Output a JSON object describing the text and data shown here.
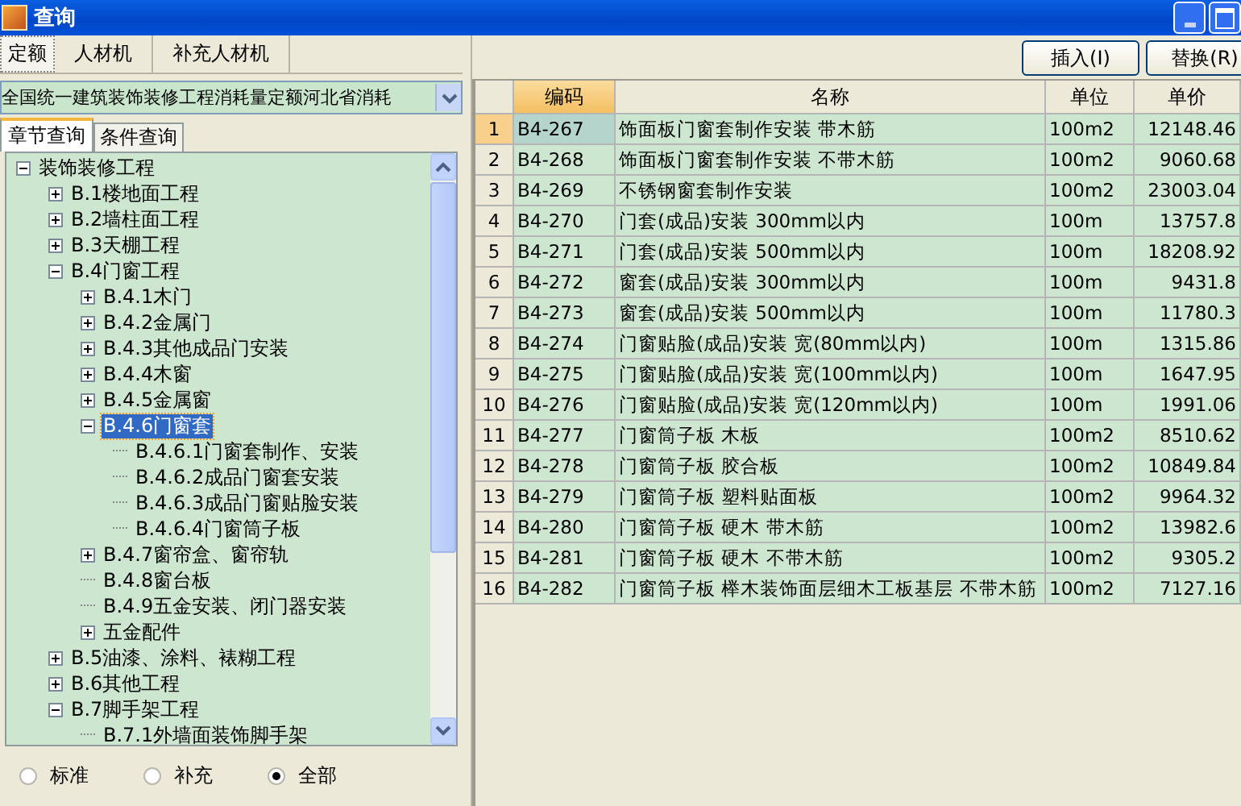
{
  "window": {
    "title": "查询"
  },
  "tabs": [
    {
      "label": "定额",
      "selected": true
    },
    {
      "label": "人材机",
      "selected": false
    },
    {
      "label": "补充人材机",
      "selected": false
    }
  ],
  "library": {
    "value": "全国统一建筑装饰装修工程消耗量定额河北省消耗"
  },
  "query_tabs": [
    {
      "label": "章节查询",
      "selected": true
    },
    {
      "label": "条件查询",
      "selected": false
    }
  ],
  "tree": [
    {
      "label": "装饰装修工程",
      "expanded": true,
      "selected": false,
      "children": [
        {
          "label": "B.1楼地面工程",
          "expanded": false,
          "selected": false
        },
        {
          "label": "B.2墙柱面工程",
          "expanded": false,
          "selected": false
        },
        {
          "label": "B.3天棚工程",
          "expanded": false,
          "selected": false
        },
        {
          "label": "B.4门窗工程",
          "expanded": true,
          "selected": false,
          "children": [
            {
              "label": "B.4.1木门",
              "expanded": false,
              "selected": false
            },
            {
              "label": "B.4.2金属门",
              "expanded": false,
              "selected": false
            },
            {
              "label": "B.4.3其他成品门安装",
              "expanded": false,
              "selected": false
            },
            {
              "label": "B.4.4木窗",
              "expanded": false,
              "selected": false
            },
            {
              "label": "B.4.5金属窗",
              "expanded": false,
              "selected": false
            },
            {
              "label": "B.4.6门窗套",
              "expanded": true,
              "selected": true,
              "children": [
                {
                  "label": "B.4.6.1门窗套制作、安装",
                  "selected": false
                },
                {
                  "label": "B.4.6.2成品门窗套安装",
                  "selected": false
                },
                {
                  "label": "B.4.6.3成品门窗贴脸安装",
                  "selected": false
                },
                {
                  "label": "B.4.6.4门窗筒子板",
                  "selected": false
                }
              ]
            },
            {
              "label": "B.4.7窗帘盒、窗帘轨",
              "expanded": false,
              "selected": false
            },
            {
              "label": "B.4.8窗台板",
              "selected": false
            },
            {
              "label": "B.4.9五金安装、闭门器安装",
              "selected": false
            },
            {
              "label": "五金配件",
              "expanded": false,
              "selected": false
            }
          ]
        },
        {
          "label": "B.5油漆、涂料、裱糊工程",
          "expanded": false,
          "selected": false
        },
        {
          "label": "B.6其他工程",
          "expanded": false,
          "selected": false
        },
        {
          "label": "B.7脚手架工程",
          "expanded": true,
          "selected": false,
          "children": [
            {
              "label": "B.7.1外墙面装饰脚手架",
              "selected": false
            }
          ]
        }
      ]
    }
  ],
  "filter": [
    {
      "label": "标准",
      "selected": false
    },
    {
      "label": "补充",
      "selected": false
    },
    {
      "label": "全部",
      "selected": true
    }
  ],
  "buttons": [
    {
      "label": "插入(I)"
    },
    {
      "label": "替换(R)"
    }
  ],
  "table": {
    "columns": [
      {
        "label": "编码",
        "selected": true
      },
      {
        "label": "名称",
        "selected": false
      },
      {
        "label": "单位",
        "selected": false
      },
      {
        "label": "单价",
        "selected": false
      }
    ],
    "rows": [
      {
        "n": "1",
        "code": "B4-267",
        "name": "饰面板门窗套制作安装 带木筋",
        "unit": "100m2",
        "price": "12148.46",
        "selected": true
      },
      {
        "n": "2",
        "code": "B4-268",
        "name": "饰面板门窗套制作安装 不带木筋",
        "unit": "100m2",
        "price": "9060.68",
        "selected": false
      },
      {
        "n": "3",
        "code": "B4-269",
        "name": "不锈钢窗套制作安装",
        "unit": "100m2",
        "price": "23003.04",
        "selected": false
      },
      {
        "n": "4",
        "code": "B4-270",
        "name": "门套(成品)安装 300mm以内",
        "unit": "100m",
        "price": "13757.8",
        "selected": false
      },
      {
        "n": "5",
        "code": "B4-271",
        "name": "门套(成品)安装 500mm以内",
        "unit": "100m",
        "price": "18208.92",
        "selected": false
      },
      {
        "n": "6",
        "code": "B4-272",
        "name": "窗套(成品)安装 300mm以内",
        "unit": "100m",
        "price": "9431.8",
        "selected": false
      },
      {
        "n": "7",
        "code": "B4-273",
        "name": "窗套(成品)安装 500mm以内",
        "unit": "100m",
        "price": "11780.3",
        "selected": false
      },
      {
        "n": "8",
        "code": "B4-274",
        "name": "门窗贴脸(成品)安装 宽(80mm以内)",
        "unit": "100m",
        "price": "1315.86",
        "selected": false
      },
      {
        "n": "9",
        "code": "B4-275",
        "name": "门窗贴脸(成品)安装 宽(100mm以内)",
        "unit": "100m",
        "price": "1647.95",
        "selected": false
      },
      {
        "n": "10",
        "code": "B4-276",
        "name": "门窗贴脸(成品)安装 宽(120mm以内)",
        "unit": "100m",
        "price": "1991.06",
        "selected": false
      },
      {
        "n": "11",
        "code": "B4-277",
        "name": "门窗筒子板 木板",
        "unit": "100m2",
        "price": "8510.62",
        "selected": false
      },
      {
        "n": "12",
        "code": "B4-278",
        "name": "门窗筒子板 胶合板",
        "unit": "100m2",
        "price": "10849.84",
        "selected": false
      },
      {
        "n": "13",
        "code": "B4-279",
        "name": "门窗筒子板 塑料贴面板",
        "unit": "100m2",
        "price": "9964.32",
        "selected": false
      },
      {
        "n": "14",
        "code": "B4-280",
        "name": "门窗筒子板 硬木 带木筋",
        "unit": "100m2",
        "price": "13982.6",
        "selected": false
      },
      {
        "n": "15",
        "code": "B4-281",
        "name": "门窗筒子板 硬木 不带木筋",
        "unit": "100m2",
        "price": "9305.2",
        "selected": false
      },
      {
        "n": "16",
        "code": "B4-282",
        "name": "门窗筒子板 榉木装饰面层细木工板基层 不带木筋",
        "unit": "100m2",
        "price": "7127.16",
        "selected": false
      }
    ]
  }
}
